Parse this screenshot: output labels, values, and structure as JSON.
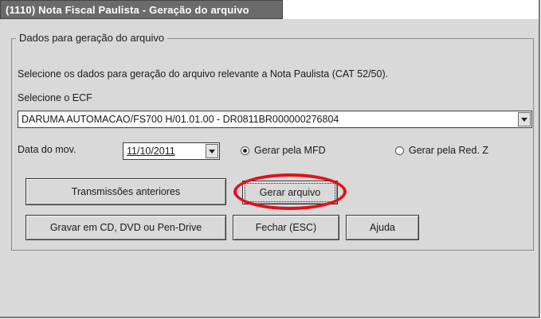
{
  "window": {
    "title": "(1110) Nota Fiscal Paulista - Geração do arquivo"
  },
  "group": {
    "legend": "Dados para geração do arquivo",
    "description": "Selecione os dados para geração do arquivo relevante a Nota Paulista (CAT 52/50).",
    "ecf_label": "Selecione o ECF"
  },
  "ecf_select": {
    "value": "DARUMA AUTOMACAO/FS700 H/01.01.00 - DR0811BR000000276804"
  },
  "date": {
    "label": "Data do mov.",
    "value": "11/10/2011"
  },
  "radios": [
    {
      "label": "Gerar pela MFD",
      "selected": true
    },
    {
      "label": "Gerar pela Red. Z",
      "selected": false
    }
  ],
  "buttons": {
    "previous": "Transmissões anteriores",
    "generate": "Gerar arquivo",
    "record": "Gravar em CD, DVD ou Pen-Drive",
    "close": "Fechar (ESC)",
    "help": "Ajuda"
  },
  "colors": {
    "highlight": "#e3101c",
    "window_bg": "#d9d9d9",
    "titlebar_bg": "#6b6b6b"
  }
}
